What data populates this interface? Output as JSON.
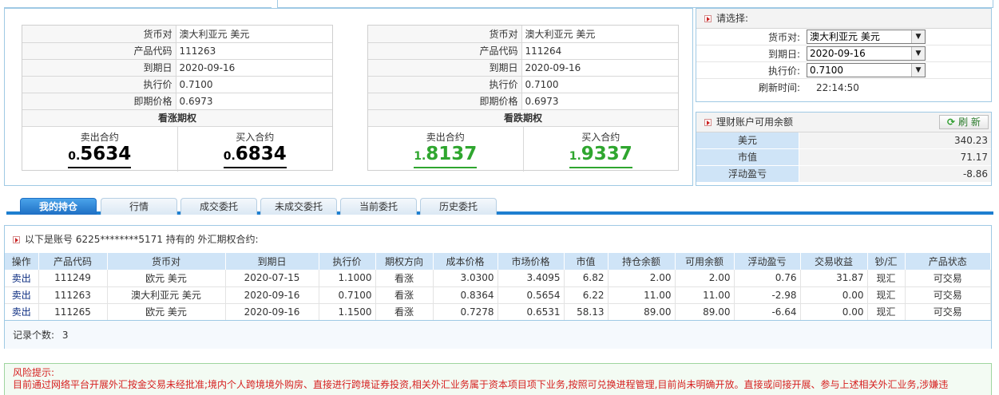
{
  "quotes": [
    {
      "pair_label": "货币对",
      "pair": "澳大利亚元 美元",
      "code_label": "产品代码",
      "code": "111263",
      "expiry_label": "到期日",
      "expiry": "2020-09-16",
      "strike_label": "执行价",
      "strike": "0.7100",
      "spot_label": "即期价格",
      "spot": "0.6973",
      "option_type": "看涨期权",
      "sell_label": "卖出合约",
      "sell_small": "0.",
      "sell_big": "5634",
      "buy_label": "买入合约",
      "buy_small": "0.",
      "buy_big": "6834",
      "color": "#000000"
    },
    {
      "pair_label": "货币对",
      "pair": "澳大利亚元 美元",
      "code_label": "产品代码",
      "code": "111264",
      "expiry_label": "到期日",
      "expiry": "2020-09-16",
      "strike_label": "执行价",
      "strike": "0.7100",
      "spot_label": "即期价格",
      "spot": "0.6973",
      "option_type": "看跌期权",
      "sell_label": "卖出合约",
      "sell_small": "1.",
      "sell_big": "8137",
      "buy_label": "买入合约",
      "buy_small": "1.",
      "buy_big": "9337",
      "color": "#2fa62f"
    }
  ],
  "selector": {
    "title": "请选择:",
    "pair_label": "货币对:",
    "pair_value": "澳大利亚元 美元",
    "expiry_label": "到期日:",
    "expiry_value": "2020-09-16",
    "strike_label": "执行价:",
    "strike_value": "0.7100",
    "refresh_time_label": "刷新时间:",
    "refresh_time": "22:14:50"
  },
  "balance": {
    "title": "理财账户可用余额",
    "refresh_label": "刷 新",
    "rows": [
      {
        "label": "美元",
        "value": "340.23"
      },
      {
        "label": "市值",
        "value": "71.17"
      },
      {
        "label": "浮动盈亏",
        "value": "-8.86"
      }
    ]
  },
  "tabs": [
    "我的持仓",
    "行情",
    "成交委托",
    "未成交委托",
    "当前委托",
    "历史委托"
  ],
  "holdings": {
    "header": "以下是账号 6225********5171 持有的 外汇期权合约:",
    "columns": [
      "操作",
      "产品代码",
      "货币对",
      "到期日",
      "执行价",
      "期权方向",
      "成本价格",
      "市场价格",
      "市值",
      "持仓余额",
      "可用余额",
      "浮动盈亏",
      "交易收益",
      "钞/汇",
      "产品状态"
    ],
    "rows": [
      [
        "卖出",
        "111249",
        "欧元 美元",
        "2020-07-15",
        "1.1000",
        "看涨",
        "3.0300",
        "3.4095",
        "6.82",
        "2.00",
        "2.00",
        "0.76",
        "31.87",
        "现汇",
        "可交易"
      ],
      [
        "卖出",
        "111263",
        "澳大利亚元 美元",
        "2020-09-16",
        "0.7100",
        "看涨",
        "0.8364",
        "0.5654",
        "6.22",
        "11.00",
        "11.00",
        "-2.98",
        "0.00",
        "现汇",
        "可交易"
      ],
      [
        "卖出",
        "111265",
        "欧元 美元",
        "2020-09-16",
        "1.1500",
        "看涨",
        "0.7278",
        "0.6531",
        "58.13",
        "89.00",
        "89.00",
        "-6.64",
        "0.00",
        "现汇",
        "可交易"
      ]
    ],
    "records_label": "记录个数:",
    "records_count": "3"
  },
  "risk": {
    "title": "风险提示:",
    "body": "目前通过网络平台开展外汇按金交易未经批准;境内个人跨境境外购房、直接进行跨境证券投资,相关外汇业务属于资本项目项下业务,按照可兑换进程管理,目前尚未明确开放。直接或间接开展、参与上述相关外汇业务,涉嫌违"
  }
}
